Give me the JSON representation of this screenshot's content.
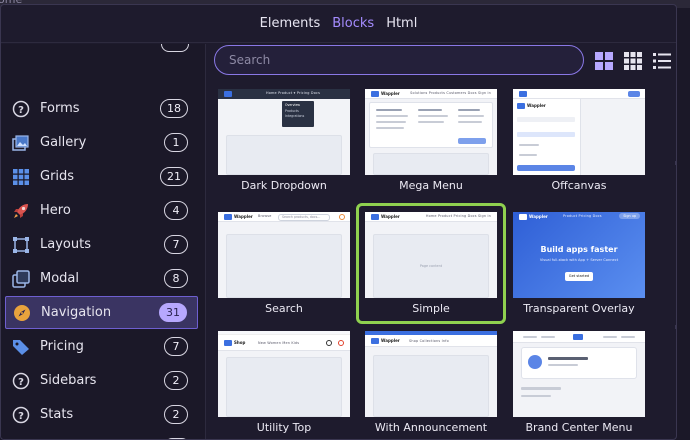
{
  "background": {
    "text": "ome"
  },
  "header": {
    "tabs": [
      {
        "label": "Elements",
        "active": false
      },
      {
        "label": "Blocks",
        "active": true
      },
      {
        "label": "Html",
        "active": false
      }
    ]
  },
  "search": {
    "placeholder": "Search",
    "value": ""
  },
  "sidebar": {
    "items": [
      {
        "label": "Forms",
        "count": "18",
        "icon": "question-circle-icon"
      },
      {
        "label": "Gallery",
        "count": "1",
        "icon": "gallery-icon"
      },
      {
        "label": "Grids",
        "count": "21",
        "icon": "grid-icon"
      },
      {
        "label": "Hero",
        "count": "4",
        "icon": "rocket-icon"
      },
      {
        "label": "Layouts",
        "count": "7",
        "icon": "layouts-icon"
      },
      {
        "label": "Modal",
        "count": "8",
        "icon": "modal-icon"
      },
      {
        "label": "Navigation",
        "count": "31",
        "icon": "compass-icon",
        "active": true
      },
      {
        "label": "Pricing",
        "count": "7",
        "icon": "price-tag-icon"
      },
      {
        "label": "Sidebars",
        "count": "2",
        "icon": "question-circle-icon"
      },
      {
        "label": "Stats",
        "count": "2",
        "icon": "question-circle-icon"
      }
    ]
  },
  "blocks": [
    {
      "caption": "Dark Dropdown",
      "nav_links": "Home  Product ▾  Pricing  Docs",
      "menu": [
        "Overview",
        "Products",
        "Integrations"
      ]
    },
    {
      "caption": "Mega Menu",
      "brand": "Wappler",
      "nav_links": "Solutions  Products  Customers  Docs   Sign in"
    },
    {
      "caption": "Offcanvas",
      "brand": "Wappler"
    },
    {
      "caption": "Transparent Overlay",
      "brand": "Wappler",
      "nav_links": "Product  Pricing  Docs",
      "nav_button": "Sign up",
      "hero_title": "Build apps faster",
      "hero_sub": "Visual full-stack with App + Server Connect",
      "hero_button": "Get started"
    },
    {
      "caption": "Search",
      "brand": "Wappler",
      "nav_links": "Browse",
      "search_text": "Search products, docs..."
    },
    {
      "caption": "Simple",
      "brand": "Wappler",
      "nav_links": "Home  Product  Pricing  Docs   Sign in",
      "content_text": "Page content",
      "selected": true
    },
    {
      "caption": "Utility Top",
      "brand": "Shop",
      "nav_links": "New  Women  Men  Kids"
    },
    {
      "caption": "With Announcement",
      "brand": "Wappler",
      "nav_links": "Shop  Collections  Info"
    },
    {
      "caption": "Brand Center Menu"
    }
  ],
  "colors": {
    "accent": "#a58cff",
    "selected_border": "#8fd14f",
    "active_item_bg": "#3a3462",
    "hero_blue": "#3b6fe0"
  }
}
